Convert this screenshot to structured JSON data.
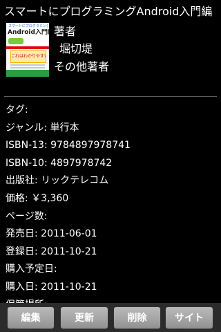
{
  "book": {
    "title": "スマートにプログラミングAndroid入門編",
    "cover": {
      "subtitle_text": "スマートにプログラミング",
      "main_text": "Android入門編",
      "banner_text": "これはわかりやすい"
    },
    "author_heading": "著者",
    "author_name": "堀切堤",
    "other_authors_heading": "その他著者"
  },
  "details": {
    "tags": "タグ:",
    "genre": "ジャンル: 単行本",
    "isbn13": "ISBN-13: 9784897978741",
    "isbn10": "ISBN-10: 4897978742",
    "publisher": "出版社: リックテレコム",
    "price": "価格: ￥3,360",
    "pages": "ページ数:",
    "release_date": "発売日: 2011-06-01",
    "registered_date": "登録日: 2011-10-21",
    "planned_purchase_date": "購入予定日:",
    "purchase_date": "購入日: 2011-10-21",
    "storage_location": "保管場所:"
  },
  "toolbar": {
    "edit_label": "編集",
    "update_label": "更新",
    "delete_label": "削除",
    "site_label": "サイト"
  },
  "colors": {
    "background": "#000000",
    "text": "#ffffff",
    "button_face": "#a5a5a5",
    "toolbar": "#2b2b2b"
  }
}
